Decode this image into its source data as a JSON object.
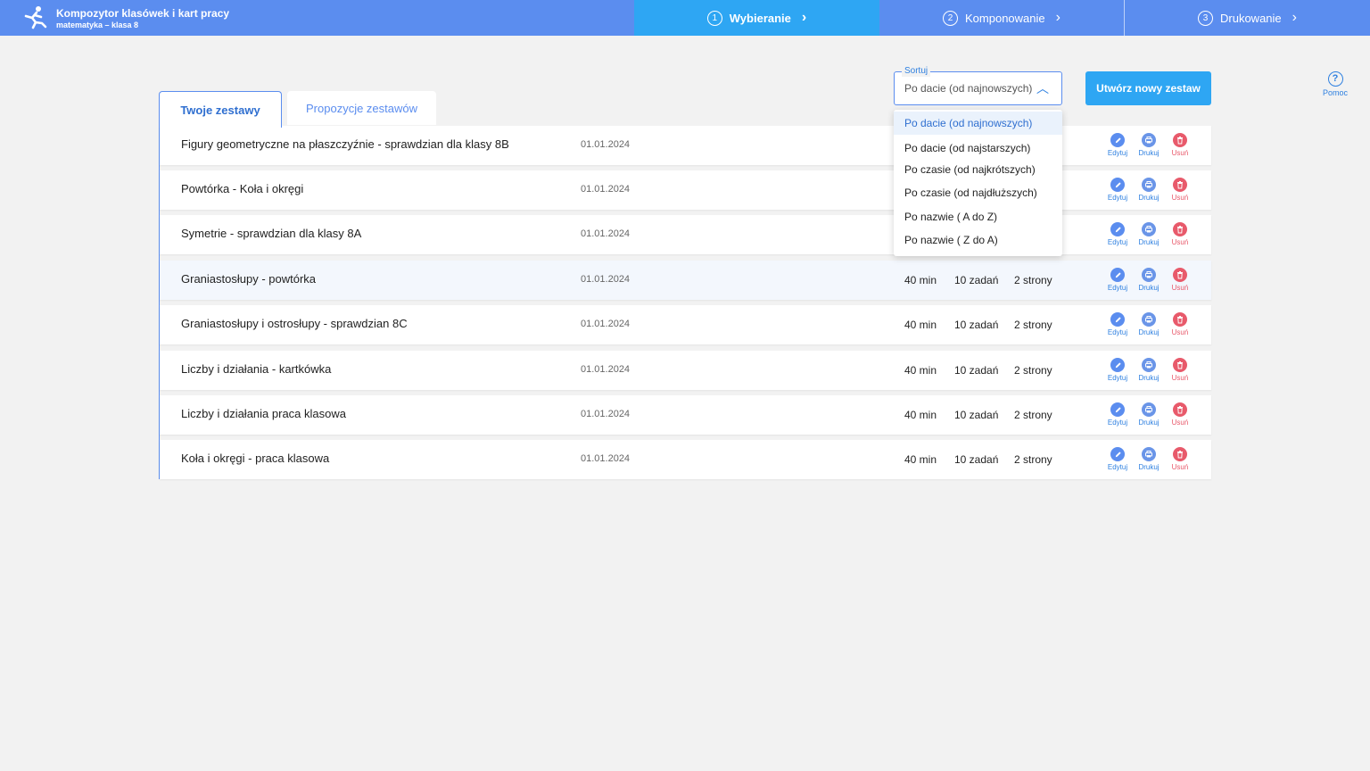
{
  "app": {
    "title": "Kompozytor klasówek i kart pracy",
    "subtitle": "matematyka – klasa 8"
  },
  "steps": [
    {
      "num": "1",
      "label": "Wybieranie"
    },
    {
      "num": "2",
      "label": "Komponowanie"
    },
    {
      "num": "3",
      "label": "Drukowanie"
    }
  ],
  "help": {
    "label": "Pomoc",
    "icon": "?"
  },
  "tabs": {
    "active": "Twoje zestawy",
    "inactive": "Propozycje zestawów"
  },
  "sort": {
    "label": "Sortuj",
    "value": "Po dacie (od najnowszych)",
    "options": [
      "Po dacie (od najnowszych)",
      "Po dacie (od najstarszych)",
      "Po czasie (od najkrótszych)",
      "Po czasie (od najdłuższych)",
      "Po nazwie ( A do Z)",
      "Po nazwie ( Z do A)"
    ]
  },
  "new_button": "Utwórz nowy zestaw",
  "actions": {
    "edit": "Edytuj",
    "print": "Drukuj",
    "delete": "Usuń"
  },
  "rows": [
    {
      "title": "Figury geometryczne na płaszczyźnie -  sprawdzian dla klasy 8B",
      "date": "01.01.2024",
      "time": "",
      "tasks": "",
      "pages": ""
    },
    {
      "title": "Powtórka - Koła i okręgi",
      "date": "01.01.2024",
      "time": "",
      "tasks": "",
      "pages": ""
    },
    {
      "title": "Symetrie - sprawdzian dla klasy 8A",
      "date": "01.01.2024",
      "time": "",
      "tasks": "",
      "pages": ""
    },
    {
      "title": "Graniastosłupy - powtórka",
      "date": "01.01.2024",
      "time": "40 min",
      "tasks": "10 zadań",
      "pages": "2 strony"
    },
    {
      "title": "Graniastosłupy i ostrosłupy - sprawdzian 8C",
      "date": "01.01.2024",
      "time": "40 min",
      "tasks": "10 zadań",
      "pages": "2 strony"
    },
    {
      "title": "Liczby i działania - kartkówka",
      "date": "01.01.2024",
      "time": "40 min",
      "tasks": "10 zadań",
      "pages": "2 strony"
    },
    {
      "title": "Liczby i działania praca klasowa",
      "date": "01.01.2024",
      "time": "40 min",
      "tasks": "10 zadań",
      "pages": "2 strony"
    },
    {
      "title": "Koła i okręgi - praca klasowa",
      "date": "01.01.2024",
      "time": "40 min",
      "tasks": "10 zadań",
      "pages": "2 strony"
    }
  ],
  "colors": {
    "topbar": "#5b8def",
    "active_step": "#2ea6f3",
    "accent": "#2f80e0",
    "delete": "#e85a6b"
  }
}
